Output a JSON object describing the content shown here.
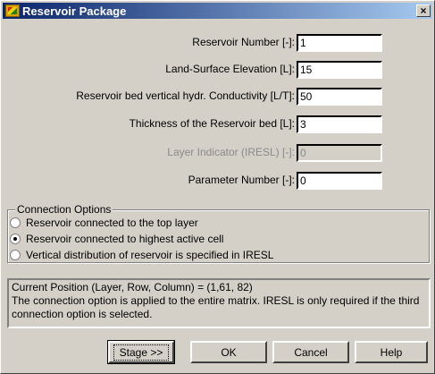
{
  "window": {
    "title": "Reservoir Package",
    "close_label": "×"
  },
  "fields": [
    {
      "label": "Reservoir Number [-]:",
      "value": "1",
      "disabled": false
    },
    {
      "label": "Land-Surface Elevation [L]:",
      "value": "15",
      "disabled": false
    },
    {
      "label": "Reservoir bed vertical hydr. Conductivity [L/T]:",
      "value": "50",
      "disabled": false
    },
    {
      "label": "Thickness of the Reservoir bed [L]:",
      "value": "3",
      "disabled": false
    },
    {
      "label": "Layer Indicator (IRESL) [-]:",
      "value": "0",
      "disabled": true
    },
    {
      "label": "Parameter Number [-]:",
      "value": "0",
      "disabled": false
    }
  ],
  "connection_options": {
    "title": "Connection Options",
    "options": [
      {
        "label": "Reservoir connected to the top layer",
        "checked": false
      },
      {
        "label": "Reservoir connected to highest active cell",
        "checked": true
      },
      {
        "label": "Vertical distribution of reservoir is specified in IRESL",
        "checked": false
      }
    ]
  },
  "info": {
    "line1": "Current Position (Layer, Row, Column) = (1,61, 82)",
    "line2": "The connection option is applied to the entire matrix. IRESL is only required if the third connection option is selected."
  },
  "buttons": {
    "stage": "Stage >>",
    "ok": "OK",
    "cancel": "Cancel",
    "help": "Help"
  }
}
